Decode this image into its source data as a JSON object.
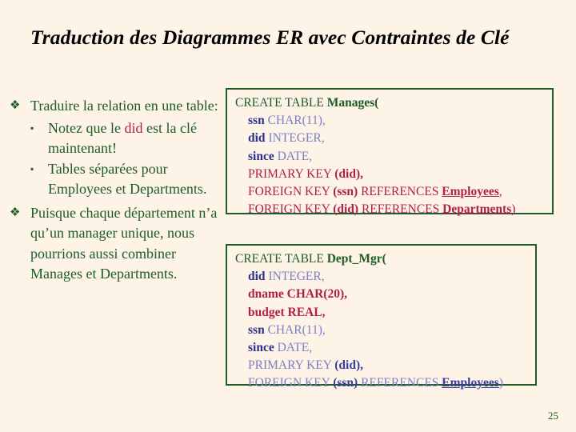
{
  "slide": {
    "title": "Traduction des Diagrammes ER avec  Contraintes de Clé",
    "page_number": "25",
    "background_color": "#fdf3e7",
    "text_color_green": "#1d5c26",
    "text_color_crimson": "#b02048",
    "text_color_blue": "#3a3da0",
    "box_border_color": "#1d5c26"
  },
  "bullets": [
    {
      "marker": "❖",
      "text": "Traduire la relation en une table:",
      "sub_items": [
        {
          "marker": "▪",
          "parts": [
            {
              "text": "Notez que le ",
              "style": "green"
            },
            {
              "text": "did",
              "style": "crimson"
            },
            {
              "text": " est la clé maintenant!",
              "style": "green"
            }
          ],
          "plain": "Notez que le did est la clé maintenant!"
        },
        {
          "marker": "▪",
          "parts": [
            {
              "text": "Tables séparées pour Employees et Departments.",
              "style": "green"
            }
          ],
          "plain": "Tables séparées pour Employees et Departments."
        }
      ]
    },
    {
      "marker": "❖",
      "text": "Puisque chaque département n’a qu’un manager unique, nous pourrions aussi combiner Manages et Departments.",
      "sub_items": []
    }
  ],
  "code_boxes": [
    {
      "id": "box-manages",
      "table_name": "Manages",
      "lines": [
        {
          "indent": false,
          "tokens": [
            {
              "text": "CREATE TABLE ",
              "style": "green"
            },
            {
              "text": "Manages(",
              "style": "green-bold"
            }
          ]
        },
        {
          "indent": true,
          "tokens": [
            {
              "text": "ssn",
              "style": "navy-bold"
            },
            {
              "text": "  CHAR(11),",
              "style": "blue"
            }
          ]
        },
        {
          "indent": true,
          "tokens": [
            {
              "text": "did",
              "style": "navy-bold"
            },
            {
              "text": "  INTEGER,",
              "style": "blue"
            }
          ]
        },
        {
          "indent": true,
          "tokens": [
            {
              "text": "since",
              "style": "navy-bold"
            },
            {
              "text": "  DATE,",
              "style": "blue"
            }
          ]
        },
        {
          "indent": true,
          "tokens": [
            {
              "text": "PRIMARY KEY ",
              "style": "crimson"
            },
            {
              "text": " (did),",
              "style": "crimson-bold"
            }
          ]
        },
        {
          "indent": true,
          "tokens": [
            {
              "text": "FOREIGN KEY ",
              "style": "crimson"
            },
            {
              "text": "(ssn)",
              "style": "crimson-bold"
            },
            {
              "text": " REFERENCES ",
              "style": "crimson"
            },
            {
              "text": "Employees",
              "style": "crimson-bold-underline"
            },
            {
              "text": ",",
              "style": "crimson"
            }
          ]
        },
        {
          "indent": true,
          "tokens": [
            {
              "text": "FOREIGN KEY ",
              "style": "crimson"
            },
            {
              "text": "(did)",
              "style": "crimson-bold"
            },
            {
              "text": " REFERENCES ",
              "style": "crimson"
            },
            {
              "text": "Departments",
              "style": "crimson-bold-underline"
            },
            {
              "text": ")",
              "style": "crimson"
            }
          ]
        }
      ],
      "plain_text": "CREATE TABLE Manages( ssn CHAR(11), did INTEGER, since DATE, PRIMARY KEY (did), FOREIGN KEY (ssn) REFERENCES Employees, FOREIGN KEY (did) REFERENCES Departments)"
    },
    {
      "id": "box-deptmgr",
      "table_name": "Dept_Mgr",
      "lines": [
        {
          "indent": false,
          "tokens": [
            {
              "text": "CREATE TABLE ",
              "style": "green"
            },
            {
              "text": "Dept_Mgr(",
              "style": "green-bold"
            }
          ]
        },
        {
          "indent": true,
          "tokens": [
            {
              "text": "did",
              "style": "navy-bold"
            },
            {
              "text": "  INTEGER,",
              "style": "blue"
            }
          ]
        },
        {
          "indent": true,
          "tokens": [
            {
              "text": "dname  CHAR(20),",
              "style": "crimson-bold"
            }
          ]
        },
        {
          "indent": true,
          "tokens": [
            {
              "text": "budget  REAL,",
              "style": "crimson-bold"
            }
          ]
        },
        {
          "indent": true,
          "tokens": [
            {
              "text": "ssn",
              "style": "navy-bold"
            },
            {
              "text": "  CHAR(11),",
              "style": "blue"
            }
          ]
        },
        {
          "indent": true,
          "tokens": [
            {
              "text": "since",
              "style": "navy-bold"
            },
            {
              "text": "  DATE,",
              "style": "blue"
            }
          ]
        },
        {
          "indent": true,
          "tokens": [
            {
              "text": "PRIMARY KEY ",
              "style": "blue"
            },
            {
              "text": " (did),",
              "style": "blue-bold"
            }
          ]
        },
        {
          "indent": true,
          "tokens": [
            {
              "text": "FOREIGN KEY ",
              "style": "blue"
            },
            {
              "text": "(ssn)",
              "style": "blue-bold"
            },
            {
              "text": " REFERENCES ",
              "style": "blue"
            },
            {
              "text": "Employees",
              "style": "blue-bold-underline"
            },
            {
              "text": ")",
              "style": "blue"
            }
          ]
        }
      ],
      "plain_text": "CREATE TABLE Dept_Mgr( did INTEGER, dname CHAR(20), budget REAL, ssn CHAR(11), since DATE, PRIMARY KEY (did), FOREIGN KEY (ssn) REFERENCES Employees)"
    }
  ]
}
